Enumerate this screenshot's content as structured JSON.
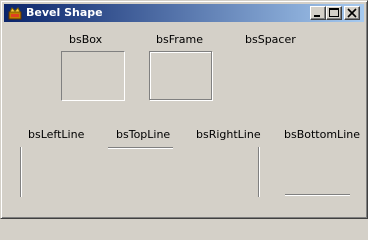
{
  "window": {
    "title": "Bevel Shape",
    "icon": "app-icon",
    "controls": {
      "minimize": "minimize-icon",
      "maximize": "maximize-icon",
      "close": "close-icon"
    }
  },
  "shapes": {
    "box": "bsBox",
    "frame": "bsFrame",
    "spacer": "bsSpacer",
    "left_line": "bsLeftLine",
    "top_line": "bsTopLine",
    "right_line": "bsRightLine",
    "bottom_line": "bsBottomLine"
  },
  "colors": {
    "face": "#d4d0c8",
    "title_start": "#0a246a",
    "title_end": "#a6caf0",
    "shadow": "#808080",
    "highlight": "#ffffff"
  }
}
